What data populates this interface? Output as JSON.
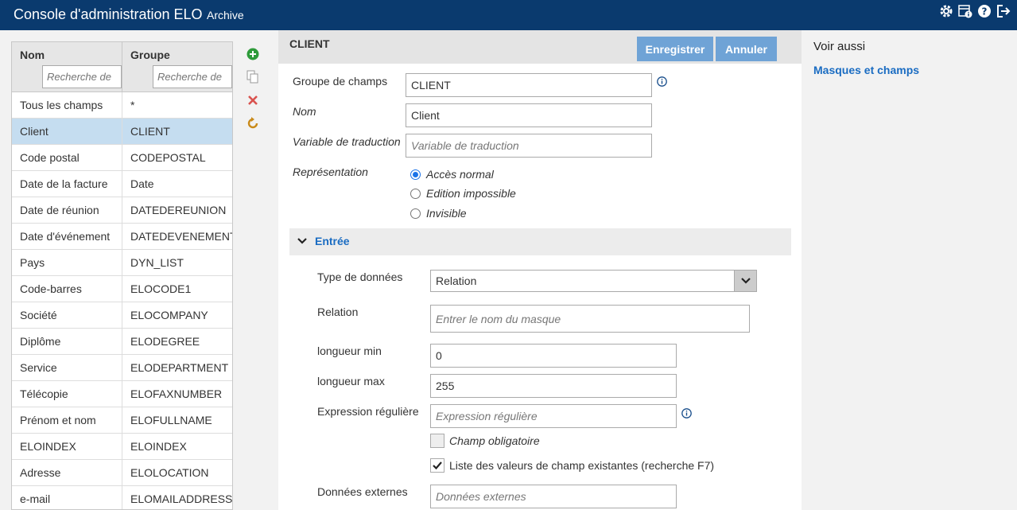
{
  "app": {
    "title": "Console d'administration ELO",
    "subtitle": "Archive"
  },
  "header_icons": [
    "gear-icon",
    "archive-info-icon",
    "help-icon",
    "logout-icon"
  ],
  "list": {
    "col1_header": "Nom",
    "col2_header": "Groupe",
    "search_placeholder_1": "Recherche de",
    "search_placeholder_2": "Recherche de",
    "rows": [
      {
        "nom": "Tous les champs",
        "groupe": "*"
      },
      {
        "nom": "Client",
        "groupe": "CLIENT"
      },
      {
        "nom": "Code postal",
        "groupe": "CODEPOSTAL"
      },
      {
        "nom": "Date de la facture",
        "groupe": "Date"
      },
      {
        "nom": "Date de réunion",
        "groupe": "DATEDEREUNION"
      },
      {
        "nom": "Date d'événement",
        "groupe": "DATEDEVENEMENT"
      },
      {
        "nom": "Pays",
        "groupe": "DYN_LIST"
      },
      {
        "nom": "Code-barres",
        "groupe": "ELOCODE1"
      },
      {
        "nom": "Société",
        "groupe": "ELOCOMPANY"
      },
      {
        "nom": "Diplôme",
        "groupe": "ELODEGREE"
      },
      {
        "nom": "Service",
        "groupe": "ELODEPARTMENT"
      },
      {
        "nom": "Télécopie",
        "groupe": "ELOFAXNUMBER"
      },
      {
        "nom": "Prénom et nom",
        "groupe": "ELOFULLNAME"
      },
      {
        "nom": "ELOINDEX",
        "groupe": "ELOINDEX"
      },
      {
        "nom": "Adresse",
        "groupe": "ELOLOCATION"
      },
      {
        "nom": "e-mail",
        "groupe": "ELOMAILADDRESS"
      }
    ]
  },
  "form": {
    "title": "CLIENT",
    "save_label": "Enregistrer",
    "cancel_label": "Annuler",
    "groupe_label": "Groupe de champs",
    "groupe_value": "CLIENT",
    "nom_label": "Nom",
    "nom_value": "Client",
    "trad_label": "Variable de traduction",
    "trad_placeholder": "Variable de traduction",
    "repr_label": "Représentation",
    "repr_options": [
      "Accès normal",
      "Edition impossible",
      "Invisible"
    ],
    "section_title": "Entrée",
    "type_label": "Type de données",
    "type_value": "Relation",
    "relation_label": "Relation",
    "relation_placeholder": "Entrer le nom du masque",
    "min_label": "longueur min",
    "min_value": "0",
    "max_label": "longueur max",
    "max_value": "255",
    "regex_label": "Expression régulière",
    "regex_placeholder": "Expression régulière",
    "required_label": "Champ obligatoire",
    "list_values_label": "Liste des valeurs de champ existantes (recherche F7)",
    "external_label": "Données externes",
    "external_placeholder": "Données externes"
  },
  "right": {
    "title": "Voir aussi",
    "link": "Masques et champs"
  }
}
